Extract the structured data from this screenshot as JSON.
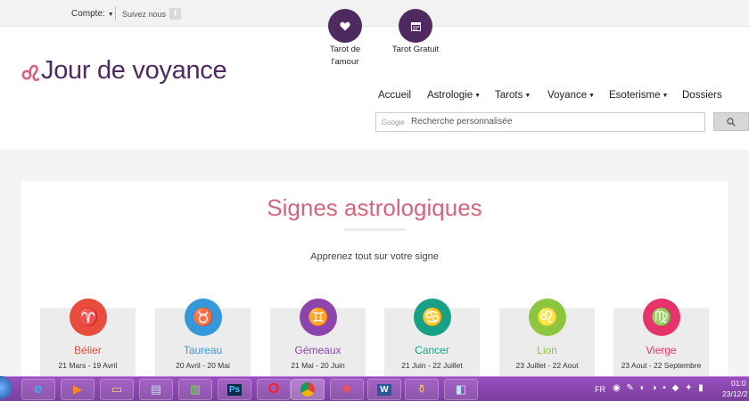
{
  "topbar": {
    "account_label": "Compte:",
    "follow_label": "Suivez nous",
    "facebook_glyph": "f"
  },
  "quick_links": [
    {
      "label_line1": "Tarot de",
      "label_line2": "l'amour",
      "icon": "heart-icon"
    },
    {
      "label_line1": "Tarot Gratuit",
      "label_line2": "",
      "icon": "calendar-icon"
    }
  ],
  "logo": {
    "text": "Jour de voyance",
    "icon": "leo-logo-icon"
  },
  "nav": {
    "items": [
      {
        "label": "Accueil",
        "dropdown": false
      },
      {
        "label": "Astrologie",
        "dropdown": true
      },
      {
        "label": "Tarots",
        "dropdown": true
      },
      {
        "label": "Voyance",
        "dropdown": true
      },
      {
        "label": "Esoterisme",
        "dropdown": true
      },
      {
        "label": "Dossiers",
        "dropdown": false
      }
    ]
  },
  "search": {
    "brand": "Google",
    "placeholder": "Recherche personnalisée",
    "button_icon": "search-icon"
  },
  "main": {
    "title": "Signes astrologiques",
    "subtitle": "Apprenez tout sur votre signe"
  },
  "signs": [
    {
      "name": "Bélier",
      "dates": "21 Mars - 19 Avril",
      "symbol": "♈",
      "color": "#e74c3c"
    },
    {
      "name": "Taureau",
      "dates": "20 Avril - 20 Mai",
      "symbol": "♉",
      "color": "#3498db"
    },
    {
      "name": "Gémeaux",
      "dates": "21 Mai - 20 Juin",
      "symbol": "♊",
      "color": "#8e44ad"
    },
    {
      "name": "Cancer",
      "dates": "21 Juin - 22 Juillet",
      "symbol": "♋",
      "color": "#16a085"
    },
    {
      "name": "Lion",
      "dates": "23 Juillet - 22 Aout",
      "symbol": "♌",
      "color": "#8cc63f"
    },
    {
      "name": "Vierge",
      "dates": "23 Aout - 22 Septembre",
      "symbol": "♍",
      "color": "#e6336b"
    }
  ],
  "taskbar": {
    "apps": [
      "internet-explorer",
      "media-player",
      "file-explorer",
      "network-app",
      "spreadsheet-app",
      "photoshop",
      "opera",
      "chrome",
      "media-app",
      "word",
      "utility-app",
      "window-app"
    ],
    "lang": "FR",
    "time": "01:0",
    "date": "23/12/2"
  }
}
